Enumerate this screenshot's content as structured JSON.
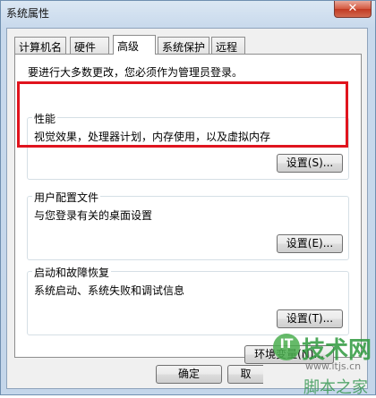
{
  "window": {
    "title": "系统属性",
    "close_glyph": "✕"
  },
  "tabs": [
    {
      "label": "计算机名"
    },
    {
      "label": "硬件"
    },
    {
      "label": "高级"
    },
    {
      "label": "系统保护"
    },
    {
      "label": "远程"
    }
  ],
  "active_tab": "高级",
  "admin_note": "要进行大多数更改，您必须作为管理员登录。",
  "performance": {
    "title": "性能",
    "description": "视觉效果，处理器计划，内存使用，以及虚拟内存",
    "settings_label": "设置(S)..."
  },
  "user_profiles": {
    "title": "用户配置文件",
    "description": "与您登录有关的桌面设置",
    "settings_label": "设置(E)..."
  },
  "startup_recovery": {
    "title": "启动和故障恢复",
    "description": "系统启动、系统失败和调试信息",
    "settings_label": "设置(T)..."
  },
  "env_button": "环境变量(N)...",
  "footer": {
    "ok_label": "确定",
    "cancel_label": "取"
  },
  "watermark": {
    "logo": "IT",
    "text": "技术网",
    "url": "www.itjs.cn",
    "sub": "脚本之家"
  },
  "colors": {
    "highlight": "#e0141e",
    "close_button": "#c13a22"
  }
}
